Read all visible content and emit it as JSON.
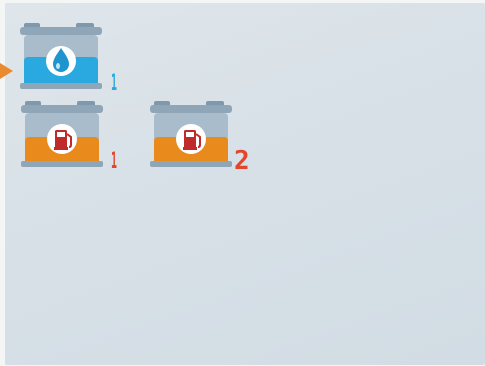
{
  "tanks": [
    {
      "type": "water",
      "icon": "water-drop-icon",
      "number": "1",
      "liquid_color": "#2aa9e0",
      "number_color": "#2aa9e0",
      "selected": true
    },
    {
      "type": "fuel",
      "icon": "fuel-pump-icon",
      "number": "1",
      "liquid_color": "#e98a1d",
      "number_color": "#e2452b",
      "selected": false
    },
    {
      "type": "fuel",
      "icon": "fuel-pump-icon",
      "number": "2",
      "liquid_color": "#e98a1d",
      "number_color": "#e2452b",
      "selected": false
    }
  ],
  "colors": {
    "selector_arrow": "#e88a2e",
    "tank_body": "#9fb4c4",
    "fuel_pump_red": "#c02a2a"
  }
}
